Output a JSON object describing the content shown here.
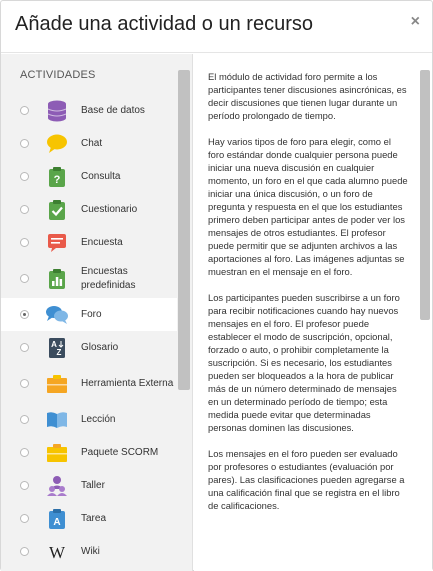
{
  "modal": {
    "title": "Añade una actividad o un recurso",
    "close_symbol": "×"
  },
  "sidebar": {
    "section_label": "ACTIVIDADES",
    "items": [
      {
        "label": "Base de datos",
        "icon": "database-icon",
        "selected": false
      },
      {
        "label": "Chat",
        "icon": "chat-icon",
        "selected": false
      },
      {
        "label": "Consulta",
        "icon": "choice-icon",
        "selected": false
      },
      {
        "label": "Cuestionario",
        "icon": "quiz-icon",
        "selected": false
      },
      {
        "label": "Encuesta",
        "icon": "feedback-icon",
        "selected": false
      },
      {
        "label": "Encuestas predefinidas",
        "icon": "survey-icon",
        "selected": false
      },
      {
        "label": "Foro",
        "icon": "forum-icon",
        "selected": true
      },
      {
        "label": "Glosario",
        "icon": "glossary-icon",
        "selected": false
      },
      {
        "label": "Herramienta Externa",
        "icon": "external-tool-icon",
        "selected": false
      },
      {
        "label": "Lección",
        "icon": "lesson-icon",
        "selected": false
      },
      {
        "label": "Paquete SCORM",
        "icon": "scorm-icon",
        "selected": false
      },
      {
        "label": "Taller",
        "icon": "workshop-icon",
        "selected": false
      },
      {
        "label": "Tarea",
        "icon": "assignment-icon",
        "selected": false
      },
      {
        "label": "Wiki",
        "icon": "wiki-icon",
        "selected": false
      }
    ]
  },
  "description": {
    "paragraphs": [
      "El módulo de actividad foro permite a los participantes tener discusiones asincrónicas, es decir discusiones que tienen lugar durante un período prolongado de tiempo.",
      "Hay varios tipos de foro para elegir, como el foro estándar donde cualquier persona puede iniciar una nueva discusión en cualquier momento, un foro en el que cada alumno puede iniciar una única discusión, o un foro de pregunta y respuesta en el que los estudiantes primero deben participar antes de poder ver los mensajes de otros estudiantes. El profesor puede permitir que se adjunten archivos a las aportaciones al foro. Las imágenes adjuntas se muestran en el mensaje en el foro.",
      "Los participantes pueden suscribirse a un foro para recibir notificaciones cuando hay nuevos mensajes en el foro. El profesor puede establecer el modo de suscripción, opcional, forzado o auto, o prohibir completamente la suscripción. Si es necesario, los estudiantes pueden ser bloqueados a la hora de publicar más de un número determinado de mensajes en un determinado período de tiempo; esta medida puede evitar que determinadas personas dominen las discusiones.",
      "Los mensajes en el foro pueden ser evaluado por profesores o estudiantes (evaluación por pares). Las clasificaciones pueden agregarse a una calificación final que se registra en el libro de calificaciones."
    ]
  },
  "colors": {
    "purple": "#8d5cb5",
    "yellow": "#f7c400",
    "green": "#5aa54a",
    "red": "#e95a4a",
    "blue": "#3f8fd2",
    "slate": "#3b4c5e",
    "orange": "#f5a623"
  }
}
